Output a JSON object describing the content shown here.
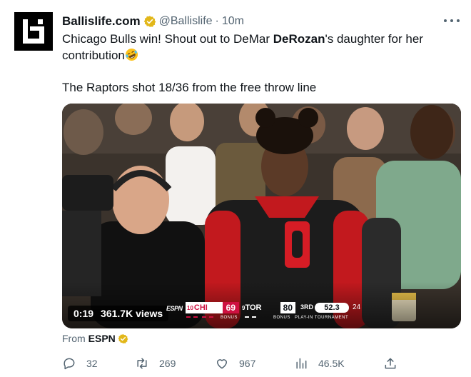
{
  "author": {
    "display_name": "Ballislife.com",
    "handle": "@Ballislife",
    "separator": "·",
    "time": "10m",
    "avatar_icon": "ballislife-logo-icon",
    "verified_icon": "gold-verified-badge-icon"
  },
  "tweet": {
    "line1_prefix": "Chicago Bulls win! Shout out to DeMar ",
    "line1_bold": "DeRozan",
    "line1_suffix": "'s daughter for her contribution",
    "emoji": "rolling-on-floor-laughing-emoji",
    "line2": "The Raptors shot 18/36 from the free throw line"
  },
  "media": {
    "elapsed": "0:19",
    "views": "361.7K views",
    "scorebug": {
      "network": "ESPN",
      "away_seed": "10",
      "away_team": "CHI",
      "away_score": "69",
      "home_seed": "9",
      "home_team": "TOR",
      "home_score": "80",
      "quarter": "3RD",
      "clock": "52.3",
      "shot_clock": "24",
      "bonus_left": "BONUS",
      "bonus_right": "BONUS",
      "tournament": "PLAY-IN TOURNAMENT"
    }
  },
  "source": {
    "prefix": "From",
    "name": "ESPN"
  },
  "actions": {
    "replies": "32",
    "retweets": "269",
    "likes": "967",
    "views": "46.5K"
  },
  "colors": {
    "text_primary": "#0f1419",
    "text_secondary": "#536471",
    "verified_gold": "#e2b719",
    "bulls_red": "#ce1141"
  }
}
